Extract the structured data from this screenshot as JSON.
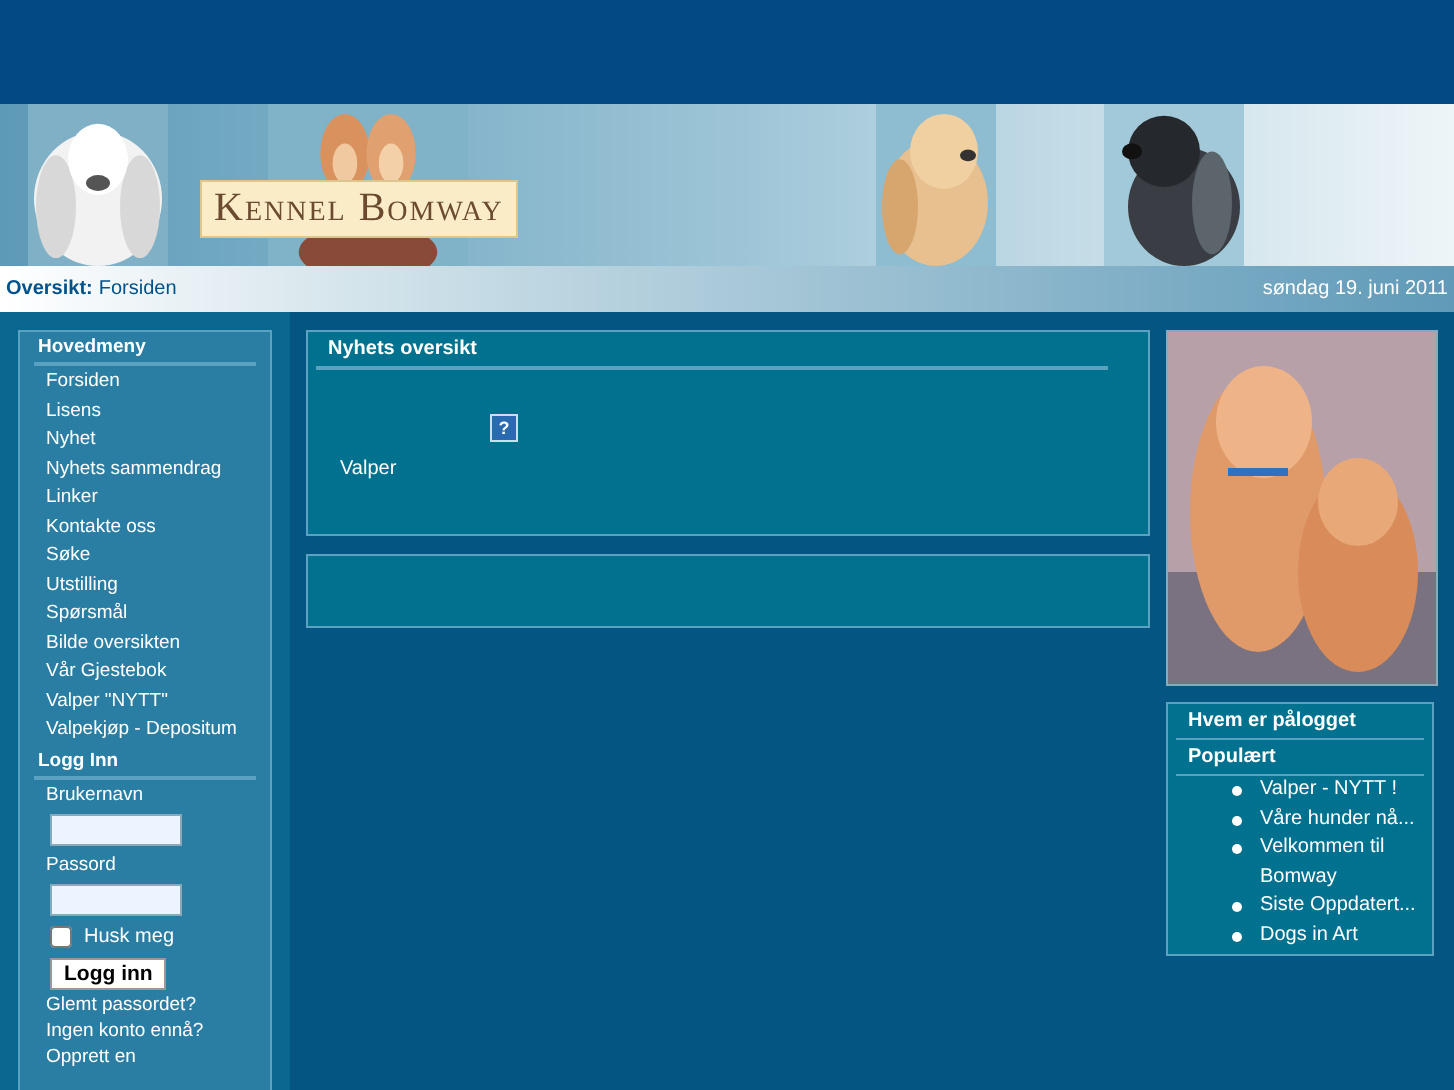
{
  "banner": {
    "logo": "Kennel Bomway"
  },
  "breadcrumb": {
    "label": "Oversikt:",
    "current": "Forsiden",
    "date": "søndag 19. juni 2011"
  },
  "main_menu": {
    "title": "Hovedmeny",
    "items": [
      "Forsiden",
      "Lisens",
      "Nyhet",
      "Nyhets sammendrag",
      "Linker",
      "Kontakte oss",
      "Søke",
      "Utstilling",
      "Spørsmål",
      "Bilde oversikten",
      "Vår Gjestebok",
      "Valper \"NYTT\"",
      "Valpekjøp - Depositum"
    ]
  },
  "login": {
    "title": "Logg Inn",
    "username_label": "Brukernavn",
    "password_label": "Passord",
    "remember": {
      "label": "Husk meg",
      "checked": false
    },
    "button": "Logg inn",
    "links": [
      "Glemt passordet?",
      "Ingen konto ennå?",
      "Opprett en"
    ]
  },
  "news": {
    "title": "Nyhets oversikt",
    "icon_text": "?",
    "item": "Valper"
  },
  "who_online": {
    "title": "Hvem er pålogget"
  },
  "popular": {
    "title": "Populært",
    "items": [
      "Valper - NYTT !",
      "Våre hunder nå...",
      "Velkommen til Bomway",
      "Siste Oppdatert...",
      "Dogs in Art"
    ]
  }
}
